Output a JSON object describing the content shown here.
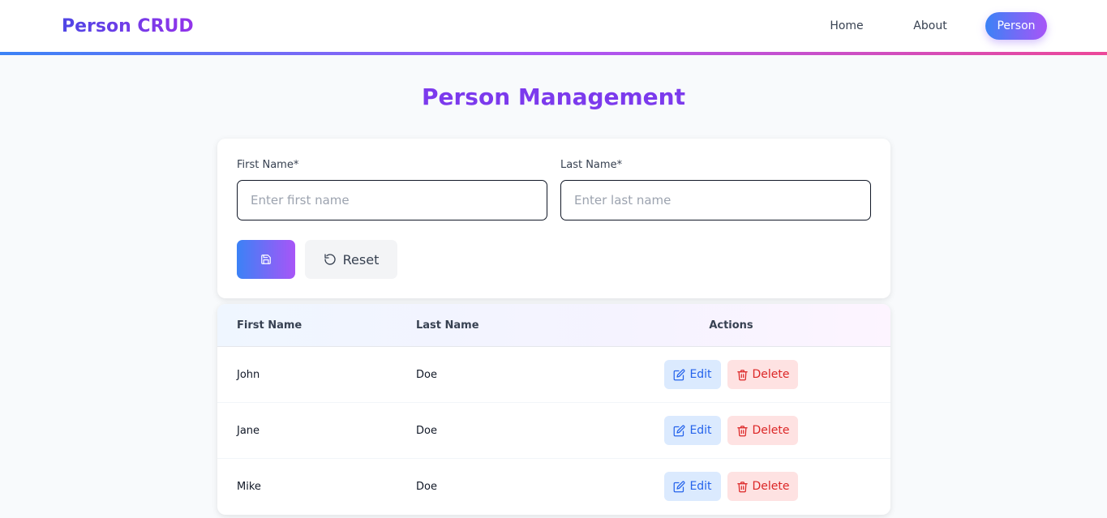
{
  "navbar": {
    "brand": "Person CRUD",
    "links": [
      {
        "label": "Home",
        "active": false
      },
      {
        "label": "About",
        "active": false
      },
      {
        "label": "Person",
        "active": true
      }
    ]
  },
  "page": {
    "title": "Person Management"
  },
  "form": {
    "first_name": {
      "label": "First Name*",
      "placeholder": "Enter first name",
      "value": ""
    },
    "last_name": {
      "label": "Last Name*",
      "placeholder": "Enter last name",
      "value": ""
    },
    "save_icon": "save-icon",
    "reset_label": "Reset",
    "reset_icon": "refresh-icon"
  },
  "table": {
    "headers": [
      "First Name",
      "Last Name",
      "Actions"
    ],
    "rows": [
      {
        "first": "John",
        "last": "Doe"
      },
      {
        "first": "Jane",
        "last": "Doe"
      },
      {
        "first": "Mike",
        "last": "Doe"
      }
    ],
    "edit_label": "Edit",
    "delete_label": "Delete",
    "edit_icon": "edit-icon",
    "delete_icon": "trash-icon"
  },
  "colors": {
    "primary_gradient_start": "#3b82f6",
    "primary_gradient_end": "#a855f7",
    "title": "#7c3aed",
    "edit_bg": "#dbeafe",
    "edit_text": "#2563eb",
    "delete_bg": "#fee2e2",
    "delete_text": "#dc2626"
  }
}
